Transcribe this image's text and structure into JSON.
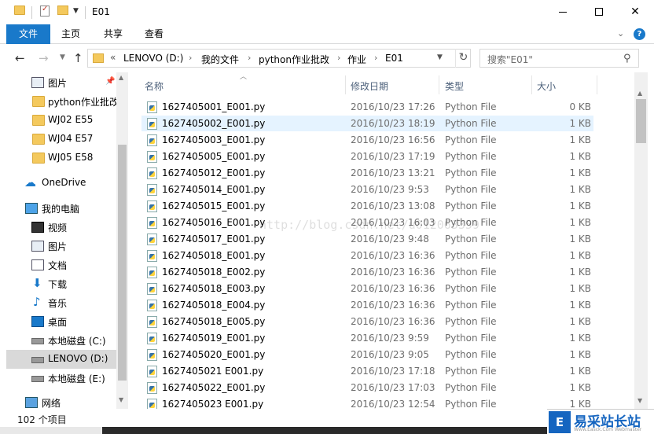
{
  "window": {
    "title": "E01"
  },
  "ribbon": {
    "tabs": [
      "文件",
      "主页",
      "共享",
      "查看"
    ]
  },
  "address": {
    "overflow": "«",
    "crumbs": [
      "LENOVO (D:)",
      "我的文件",
      "python作业批改",
      "作业",
      "E01"
    ]
  },
  "search": {
    "placeholder": "搜索\"E01\""
  },
  "sidebar": {
    "items": [
      {
        "label": "图片",
        "icon": "pictures-icon"
      },
      {
        "label": "python作业批改",
        "icon": "folder-icon"
      },
      {
        "label": "WJ02 E55",
        "icon": "folder-icon"
      },
      {
        "label": "WJ04 E57",
        "icon": "folder-icon"
      },
      {
        "label": "WJ05 E58",
        "icon": "folder-icon"
      },
      {
        "label": "OneDrive",
        "icon": "cloud-icon"
      },
      {
        "label": "我的电脑",
        "icon": "computer-icon"
      },
      {
        "label": "视频",
        "icon": "video-icon"
      },
      {
        "label": "图片",
        "icon": "pictures-icon"
      },
      {
        "label": "文档",
        "icon": "documents-icon"
      },
      {
        "label": "下载",
        "icon": "download-icon"
      },
      {
        "label": "音乐",
        "icon": "music-icon"
      },
      {
        "label": "桌面",
        "icon": "desktop-icon"
      },
      {
        "label": "本地磁盘 (C:)",
        "icon": "drive-icon"
      },
      {
        "label": "LENOVO (D:)",
        "icon": "drive-icon"
      },
      {
        "label": "本地磁盘 (E:)",
        "icon": "drive-icon"
      },
      {
        "label": "网络",
        "icon": "network-icon"
      }
    ]
  },
  "columns": {
    "name": "名称",
    "date": "修改日期",
    "type": "类型",
    "size": "大小"
  },
  "files": [
    {
      "name": "1627405001_E001.py",
      "date": "2016/10/23 17:26",
      "type": "Python File",
      "size": "0 KB"
    },
    {
      "name": "1627405002_E001.py",
      "date": "2016/10/23 18:19",
      "type": "Python File",
      "size": "1 KB"
    },
    {
      "name": "1627405003_E001.py",
      "date": "2016/10/23 16:56",
      "type": "Python File",
      "size": "1 KB"
    },
    {
      "name": "1627405005_E001.py",
      "date": "2016/10/23 17:19",
      "type": "Python File",
      "size": "1 KB"
    },
    {
      "name": "1627405012_E001.py",
      "date": "2016/10/23 13:21",
      "type": "Python File",
      "size": "1 KB"
    },
    {
      "name": "1627405014_E001.py",
      "date": "2016/10/23 9:53",
      "type": "Python File",
      "size": "1 KB"
    },
    {
      "name": "1627405015_E001.py",
      "date": "2016/10/23 13:08",
      "type": "Python File",
      "size": "1 KB"
    },
    {
      "name": "1627405016_E001.py",
      "date": "2016/10/23 16:03",
      "type": "Python File",
      "size": "1 KB"
    },
    {
      "name": "1627405017_E001.py",
      "date": "2016/10/23 9:48",
      "type": "Python File",
      "size": "1 KB"
    },
    {
      "name": "1627405018_E001.py",
      "date": "2016/10/23 16:36",
      "type": "Python File",
      "size": "1 KB"
    },
    {
      "name": "1627405018_E002.py",
      "date": "2016/10/23 16:36",
      "type": "Python File",
      "size": "1 KB"
    },
    {
      "name": "1627405018_E003.py",
      "date": "2016/10/23 16:36",
      "type": "Python File",
      "size": "1 KB"
    },
    {
      "name": "1627405018_E004.py",
      "date": "2016/10/23 16:36",
      "type": "Python File",
      "size": "1 KB"
    },
    {
      "name": "1627405018_E005.py",
      "date": "2016/10/23 16:36",
      "type": "Python File",
      "size": "1 KB"
    },
    {
      "name": "1627405019_E001.py",
      "date": "2016/10/23 9:59",
      "type": "Python File",
      "size": "1 KB"
    },
    {
      "name": "1627405020_E001.py",
      "date": "2016/10/23 9:05",
      "type": "Python File",
      "size": "1 KB"
    },
    {
      "name": "1627405021 E001.py",
      "date": "2016/10/23 17:18",
      "type": "Python File",
      "size": "1 KB"
    },
    {
      "name": "1627405022_E001.py",
      "date": "2016/10/23 17:03",
      "type": "Python File",
      "size": "1 KB"
    },
    {
      "name": "1627405023 E001.py",
      "date": "2016/10/23 12:54",
      "type": "Python File",
      "size": "1 KB"
    }
  ],
  "status": {
    "count": "102 个项目"
  },
  "watermark": {
    "text": "http://blog.csdn.net/u012063359"
  },
  "logo": {
    "badge": "E",
    "text": "易采站长站",
    "sub": "Www.Easck.Com Webmaster"
  },
  "colors": {
    "accent": "#1979ca",
    "selection": "#cce8ff",
    "hover": "#e5f3ff"
  }
}
